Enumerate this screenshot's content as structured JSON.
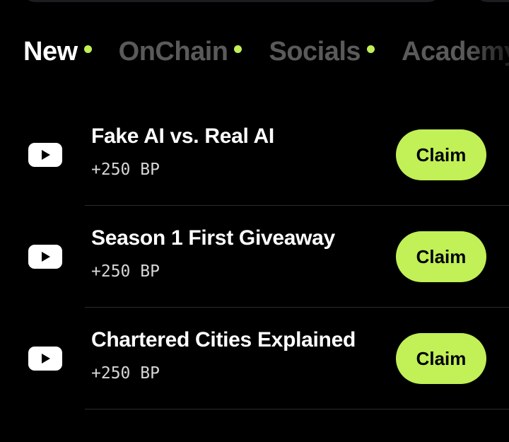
{
  "tabs": [
    {
      "label": "New",
      "active": true,
      "dot": true
    },
    {
      "label": "OnChain",
      "active": false,
      "dot": true
    },
    {
      "label": "Socials",
      "active": false,
      "dot": true
    },
    {
      "label": "Academy",
      "active": false,
      "dot": false
    }
  ],
  "tasks": [
    {
      "icon": "youtube-icon",
      "title": "Fake AI vs. Real AI",
      "reward": "+250 BP",
      "button": "Claim"
    },
    {
      "icon": "youtube-icon",
      "title": "Season 1 First Giveaway",
      "reward": "+250 BP",
      "button": "Claim"
    },
    {
      "icon": "youtube-icon",
      "title": "Chartered Cities Explained",
      "reward": "+250 BP",
      "button": "Claim"
    }
  ],
  "colors": {
    "accent": "#c1f057",
    "background": "#000000",
    "inactive_tab": "#5a5a5a"
  }
}
